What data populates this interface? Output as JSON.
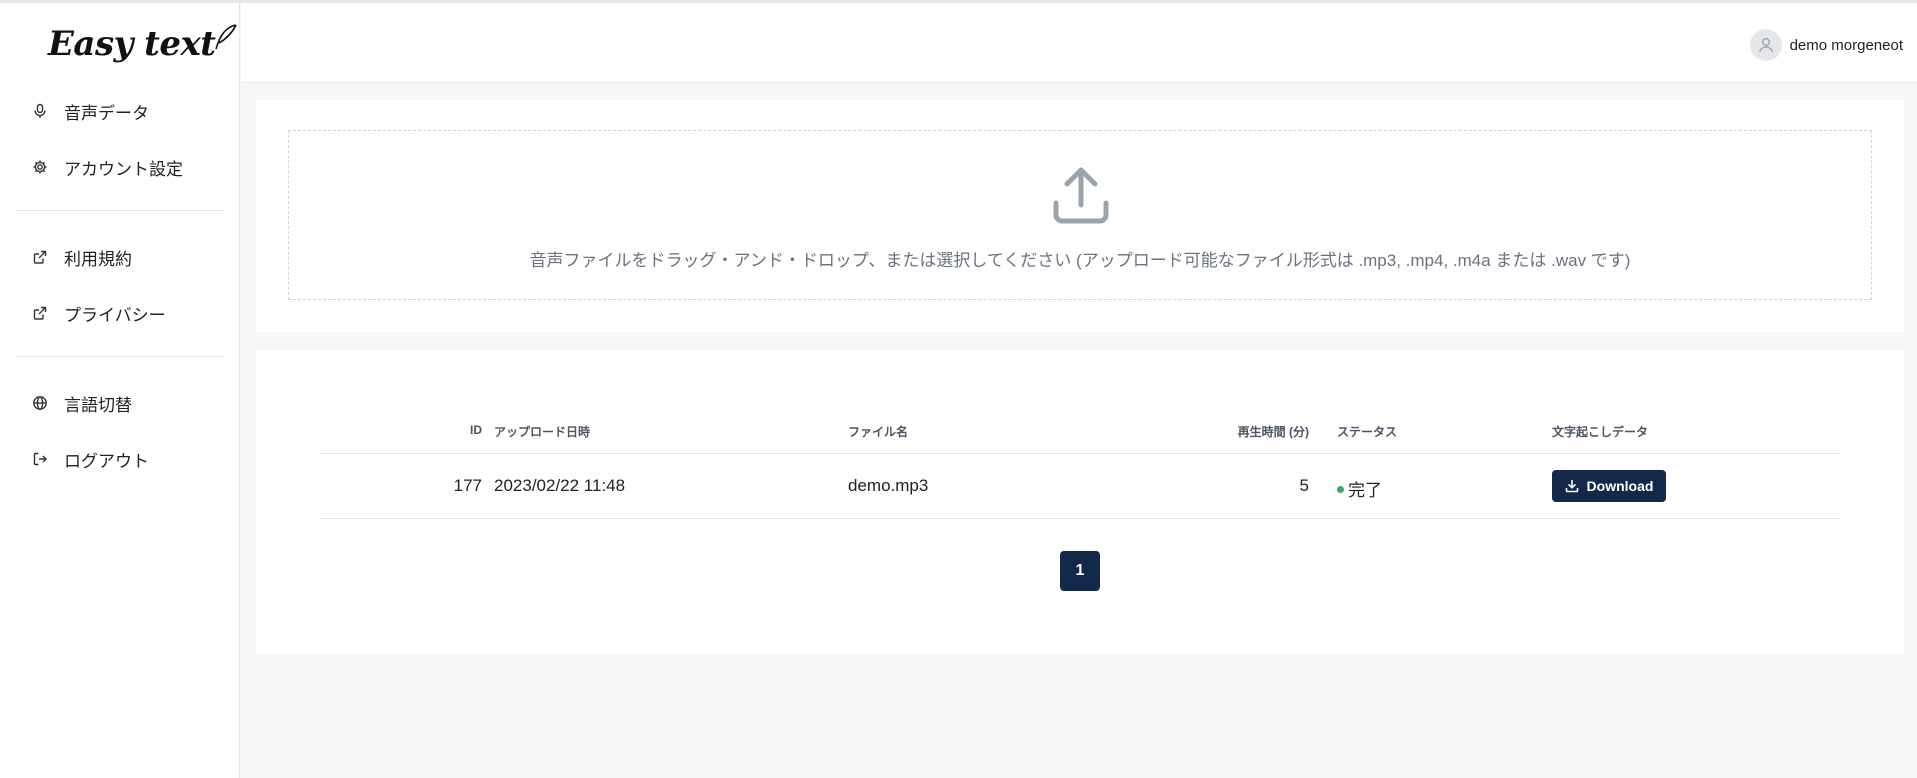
{
  "app": {
    "logo_text": "Easy text"
  },
  "sidebar": {
    "items": [
      {
        "label": "音声データ",
        "icon": "microphone-icon"
      },
      {
        "label": "アカウント設定",
        "icon": "gear-icon"
      },
      {
        "label": "利用規約",
        "icon": "external-link-icon"
      },
      {
        "label": "プライバシー",
        "icon": "external-link-icon"
      },
      {
        "label": "言語切替",
        "icon": "globe-icon"
      },
      {
        "label": "ログアウト",
        "icon": "logout-icon"
      }
    ]
  },
  "header": {
    "user_name": "demo morgeneot"
  },
  "upload": {
    "instruction": "音声ファイルをドラッグ・アンド・ドロップ、または選択してください (アップロード可能なファイル形式は .mp3, .mp4, .m4a または .wav です)"
  },
  "table": {
    "columns": [
      "ID",
      "アップロード日時",
      "ファイル名",
      "再生時間 (分)",
      "ステータス",
      "文字起こしデータ"
    ],
    "rows": [
      {
        "id": "177",
        "uploaded_at": "2023/02/22 11:48",
        "file_name": "demo.mp3",
        "duration": "5",
        "status": "完了",
        "action_label": "Download"
      }
    ]
  },
  "pagination": {
    "current_page": "1"
  },
  "colors": {
    "primary": "#14294a",
    "status_done": "#3da670",
    "background": "#f7f6f7"
  }
}
